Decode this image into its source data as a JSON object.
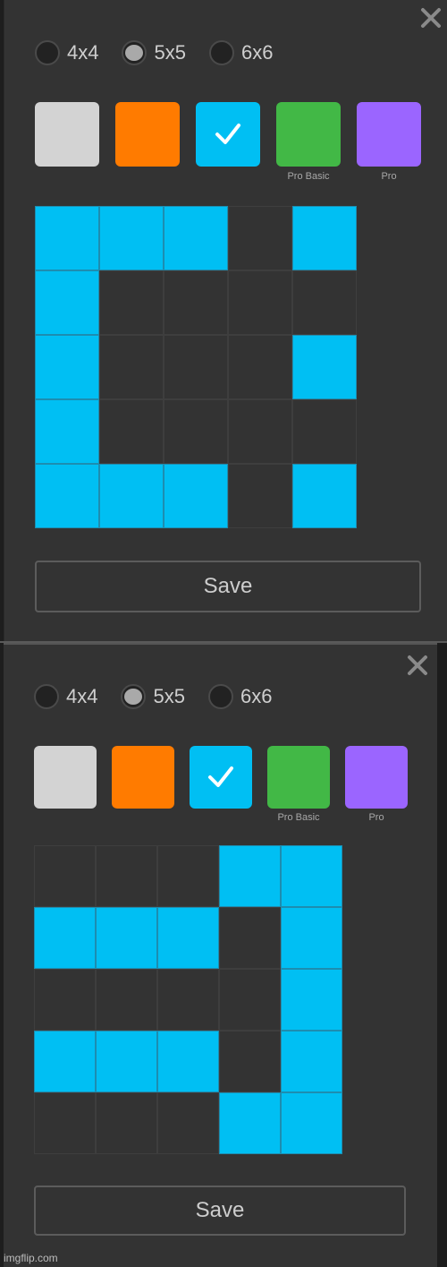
{
  "panels": [
    {
      "close_icon": "close-icon",
      "grid_size_options": [
        {
          "label": "4x4",
          "checked": false
        },
        {
          "label": "5x5",
          "checked": true
        },
        {
          "label": "6x6",
          "checked": false
        }
      ],
      "colors": [
        {
          "name": "light-gray",
          "hex": "#d3d3d3",
          "caption": "",
          "selected": false
        },
        {
          "name": "orange",
          "hex": "#ff7b00",
          "caption": "",
          "selected": false
        },
        {
          "name": "cyan",
          "hex": "#00bff3",
          "caption": "",
          "selected": true
        },
        {
          "name": "green",
          "hex": "#42b846",
          "caption": "Pro Basic",
          "selected": false
        },
        {
          "name": "purple",
          "hex": "#9b65ff",
          "caption": "Pro",
          "selected": false
        }
      ],
      "grid": [
        [
          1,
          1,
          1,
          0,
          1
        ],
        [
          1,
          0,
          0,
          0,
          0
        ],
        [
          1,
          0,
          0,
          0,
          1
        ],
        [
          1,
          0,
          0,
          0,
          0
        ],
        [
          1,
          1,
          1,
          0,
          1
        ]
      ],
      "save_label": "Save"
    },
    {
      "close_icon": "close-icon",
      "grid_size_options": [
        {
          "label": "4x4",
          "checked": false
        },
        {
          "label": "5x5",
          "checked": true
        },
        {
          "label": "6x6",
          "checked": false
        }
      ],
      "colors": [
        {
          "name": "light-gray",
          "hex": "#d3d3d3",
          "caption": "",
          "selected": false
        },
        {
          "name": "orange",
          "hex": "#ff7b00",
          "caption": "",
          "selected": false
        },
        {
          "name": "cyan",
          "hex": "#00bff3",
          "caption": "",
          "selected": true
        },
        {
          "name": "green",
          "hex": "#42b846",
          "caption": "Pro Basic",
          "selected": false
        },
        {
          "name": "purple",
          "hex": "#9b65ff",
          "caption": "Pro",
          "selected": false
        }
      ],
      "grid": [
        [
          0,
          0,
          0,
          1,
          1
        ],
        [
          1,
          1,
          1,
          0,
          1
        ],
        [
          0,
          0,
          0,
          0,
          1
        ],
        [
          1,
          1,
          1,
          0,
          1
        ],
        [
          0,
          0,
          0,
          1,
          1
        ]
      ],
      "save_label": "Save"
    }
  ],
  "watermark": "imgflip.com"
}
